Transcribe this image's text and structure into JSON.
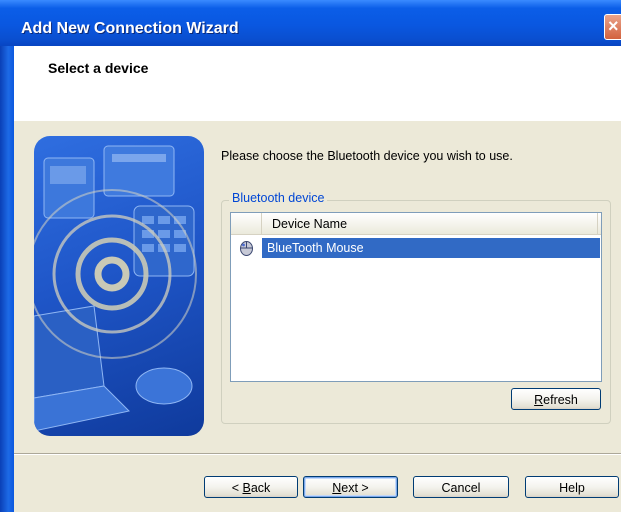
{
  "window": {
    "title": "Add New Connection Wizard"
  },
  "header": {
    "title": "Select a device"
  },
  "main": {
    "instruction": "Please choose the Bluetooth device you wish to use.",
    "group_label": "Bluetooth device",
    "list": {
      "columns": [
        "",
        "Device Name"
      ],
      "rows": [
        {
          "icon": "mouse-icon",
          "name": "BlueTooth Mouse",
          "selected": true
        }
      ]
    },
    "refresh_button": {
      "accel": "R",
      "rest": "efresh"
    }
  },
  "footer": {
    "back": {
      "prefix": "< ",
      "accel": "B",
      "rest": "ack"
    },
    "next": {
      "accel": "N",
      "rest": "ext >"
    },
    "cancel": "Cancel",
    "help": "Help"
  },
  "colors": {
    "title_bar": "#0a57e0",
    "selection": "#316ac5",
    "group_label": "#0046d5",
    "dialog_bg": "#ece9d8"
  }
}
